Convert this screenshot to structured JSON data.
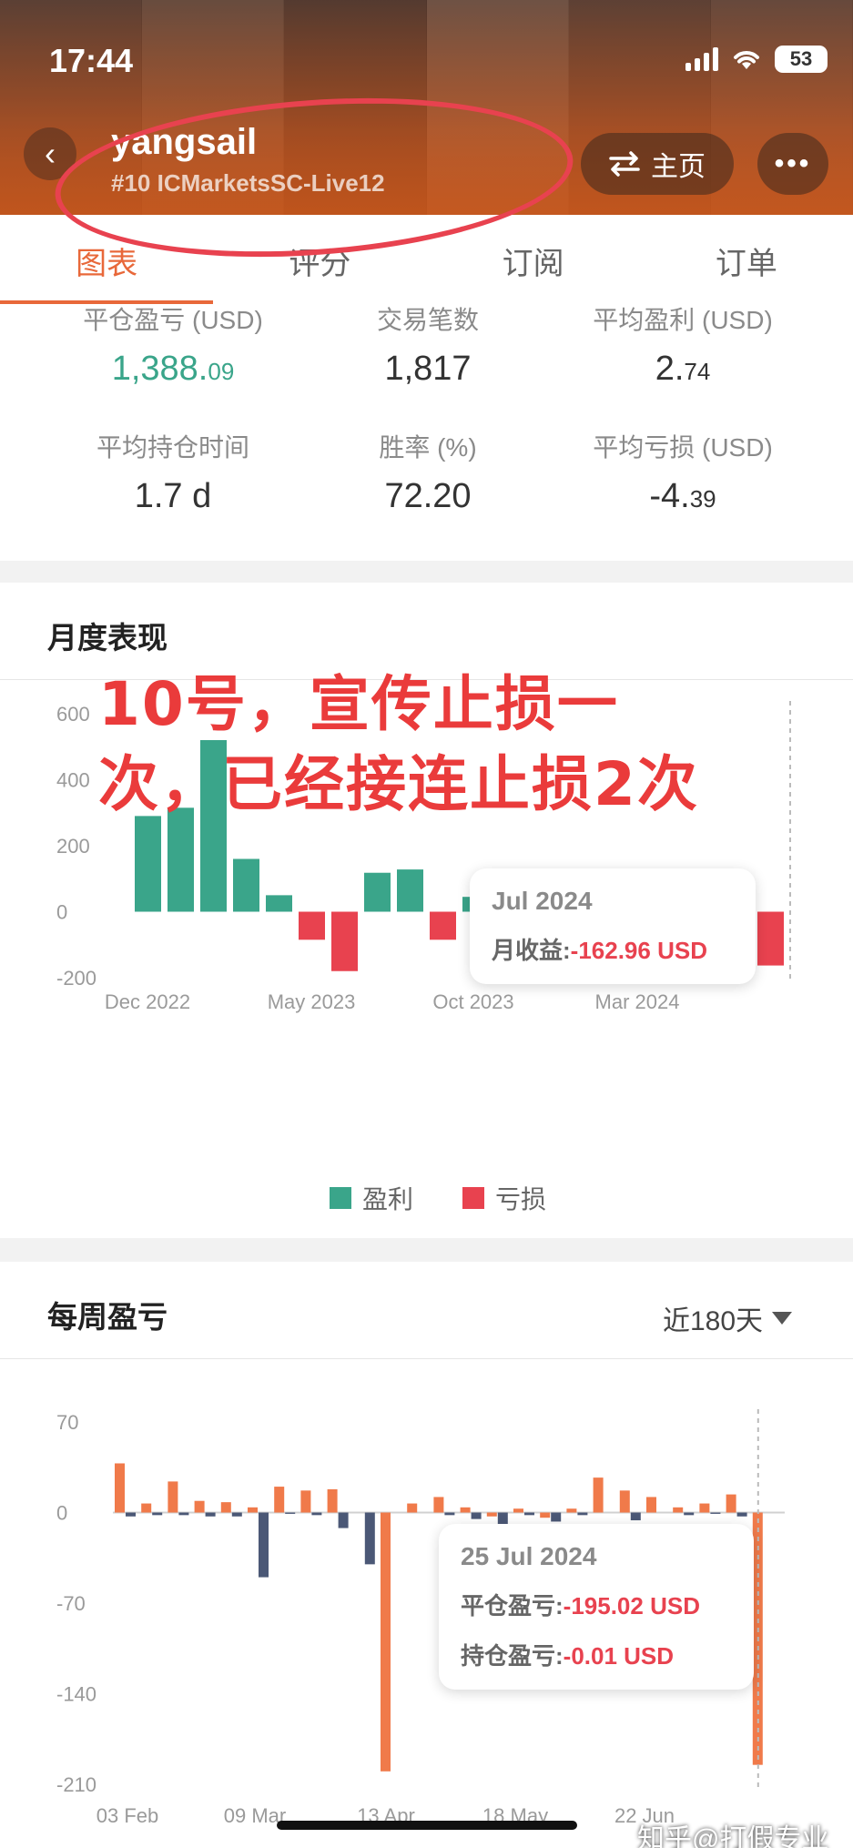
{
  "status_bar": {
    "time": "17:44",
    "battery": "53"
  },
  "profile": {
    "name": "yangsail",
    "account": "#10 ICMarketsSC-Live12",
    "home_label": "主页",
    "more_label": "•••"
  },
  "tabs": [
    {
      "label": "图表",
      "active": true
    },
    {
      "label": "评分",
      "active": false
    },
    {
      "label": "订阅",
      "active": false
    },
    {
      "label": "订单",
      "active": false
    }
  ],
  "stats": [
    {
      "label": "平仓盈亏 (USD)",
      "value_main": "1,388.",
      "value_small": "09",
      "color": "#3aa58a"
    },
    {
      "label": "交易笔数",
      "value_main": "1,817",
      "value_small": ""
    },
    {
      "label": "平均盈利 (USD)",
      "value_main": "2.",
      "value_small": "74"
    },
    {
      "label": "平均持仓时间",
      "value_main": "1.7 d",
      "value_small": ""
    },
    {
      "label": "胜率 (%)",
      "value_main": "72.20",
      "value_small": ""
    },
    {
      "label": "平均亏损 (USD)",
      "value_main": "-4.",
      "value_small": "39"
    }
  ],
  "monthly": {
    "title": "月度表现",
    "annotation_line1": "10号，宣传止损一",
    "annotation_line2": "次，已经接连止损2次",
    "tooltip": {
      "header": "Jul 2024",
      "label": "月收益:",
      "value": "-162.96 USD"
    },
    "legend": [
      {
        "label": "盈利",
        "color": "#3aa58a"
      },
      {
        "label": "亏损",
        "color": "#e8424f"
      }
    ]
  },
  "weekly": {
    "title": "每周盈亏",
    "range": "近180天",
    "tooltip": {
      "header": "25 Jul 2024",
      "row1_label": "平仓盈亏:",
      "row1_value": "-195.02 USD",
      "row2_label": "持仓盈亏:",
      "row2_value": "-0.01 USD"
    }
  },
  "watermark": "知乎@打假专业户",
  "chart_data": [
    {
      "type": "bar",
      "title": "月度表现",
      "x_tick_labels": [
        "Dec 2022",
        "May 2023",
        "Oct 2023",
        "Mar 2024"
      ],
      "y_ticks": [
        600,
        400,
        200,
        0,
        -200
      ],
      "ylim": [
        -200,
        600
      ],
      "categories": [
        "Dec 2022",
        "Jan 2023",
        "Feb 2023",
        "Mar 2023",
        "Apr 2023",
        "May 2023",
        "Jun 2023",
        "Jul 2023",
        "Aug 2023",
        "Sep 2023",
        "Oct 2023",
        "Nov 2023",
        "Dec 2023",
        "Jan 2024",
        "Feb 2024",
        "Mar 2024",
        "Apr 2024",
        "May 2024",
        "Jun 2024",
        "Jul 2024"
      ],
      "values": [
        290,
        315,
        520,
        160,
        50,
        -85,
        -180,
        118,
        128,
        -85,
        45,
        45,
        45,
        45,
        45,
        45,
        -160,
        25,
        45,
        -163
      ],
      "positive_color": "#3aa58a",
      "negative_color": "#e8424f",
      "legend": [
        "盈利",
        "亏损"
      ]
    },
    {
      "type": "bar",
      "title": "每周盈亏",
      "x_tick_labels": [
        "03 Feb",
        "09 Mar",
        "13 Apr",
        "18 May",
        "22 Jun"
      ],
      "y_ticks": [
        70,
        0,
        -70,
        -140,
        -210
      ],
      "ylim": [
        -210,
        70
      ],
      "series": [
        {
          "name": "平仓盈亏",
          "color": "#f07a4a",
          "values": [
            38,
            7,
            24,
            9,
            8,
            4,
            20,
            17,
            18,
            0,
            -200,
            7,
            12,
            4,
            -3,
            3,
            -4,
            3,
            27,
            17,
            12,
            4,
            7,
            14,
            -195
          ]
        },
        {
          "name": "持仓盈亏",
          "color": "#4b5876",
          "values": [
            -3,
            -2,
            -2,
            -3,
            -3,
            -50,
            -1,
            -2,
            -12,
            -40,
            0,
            0,
            -2,
            -5,
            -12,
            -2,
            -7,
            -2,
            0,
            -6,
            0,
            -2,
            -1,
            -3,
            0
          ]
        }
      ]
    }
  ]
}
